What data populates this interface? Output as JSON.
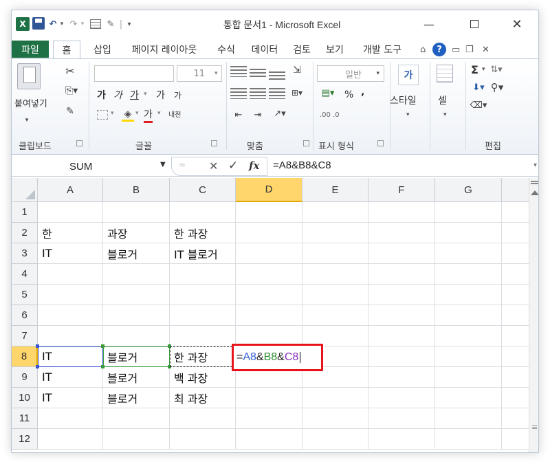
{
  "window": {
    "title": "통합 문서1  -  Microsoft Excel",
    "app_icon_letter": "X",
    "min_glyph": "—",
    "close_glyph": "╳"
  },
  "tabs": {
    "file": "파일",
    "items": [
      "홈",
      "삽입",
      "페이지 레이아웃",
      "수식",
      "데이터",
      "검토",
      "보기",
      "개발 도구"
    ]
  },
  "ribbon": {
    "clipboard": {
      "paste_label": "붙여넣기",
      "group_label": "클립보드"
    },
    "font": {
      "font_size": "11",
      "bold": "가",
      "italic": "가",
      "underline": "가",
      "grow": "가",
      "shrink": "가",
      "font_color_letter": "가",
      "phonetic": "내천",
      "group_label": "글꼴"
    },
    "alignment": {
      "group_label": "맞춤"
    },
    "number": {
      "format": "일반",
      "percent": "%",
      "comma": "\u0019",
      "dec_inc": ".00 .0",
      "group_label": "표시 형식"
    },
    "styles": {
      "label": "스타일"
    },
    "cells": {
      "label": "셀"
    },
    "editing": {
      "sum": "Σ",
      "group_label": "편집"
    }
  },
  "formula_bar": {
    "name_box": "SUM",
    "cancel_glyph": "✕",
    "enter_glyph": "✓",
    "fx_glyph": "fx",
    "formula": "=A8&B8&C8"
  },
  "sheet": {
    "columns": [
      "A",
      "B",
      "C",
      "D",
      "E",
      "F",
      "G"
    ],
    "rows": [
      "1",
      "2",
      "3",
      "4",
      "5",
      "6",
      "7",
      "8",
      "9",
      "10",
      "11",
      "12"
    ],
    "cells": {
      "A2": "한",
      "B2": "과장",
      "C2": "한 과장",
      "A3": "IT",
      "B3": "블로거",
      "C3": "IT 블로거",
      "A8": "IT",
      "B8": "블로거",
      "C8": "한 과장",
      "A9": "IT",
      "B9": "블로거",
      "C9": "백 과장",
      "A10": "IT",
      "B10": "블로거",
      "C10": "최 과장"
    },
    "active_cell": "D8",
    "edit": {
      "eq": "=",
      "a": "A8",
      "amp1": "&",
      "b": "B8",
      "amp2": "&",
      "c": "C8"
    }
  }
}
